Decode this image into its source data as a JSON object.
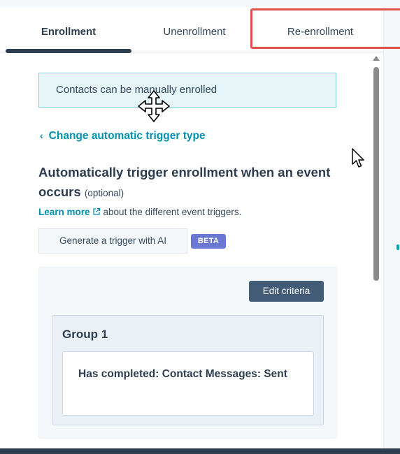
{
  "tabs": [
    {
      "label": "Enrollment"
    },
    {
      "label": "Unenrollment"
    },
    {
      "label": "Re-enrollment"
    }
  ],
  "alert": {
    "text": "Contacts can be manually enrolled"
  },
  "back_link": {
    "chevron": "‹",
    "label": "Change automatic trigger type"
  },
  "heading": {
    "main": "Automatically trigger enrollment when an event occurs",
    "optional": "(optional)"
  },
  "learn_more": {
    "link": "Learn more",
    "icon": "external-link-icon",
    "text": "about the different event triggers."
  },
  "generate_button": {
    "label": "Generate a trigger with AI"
  },
  "beta_badge": {
    "label": "BETA"
  },
  "edit_criteria_button": {
    "label": "Edit criteria"
  },
  "group": {
    "title": "Group 1",
    "filter": "Has completed: Contact Messages: Sent"
  },
  "colors": {
    "accent": "#0091ae",
    "highlight": "#e2504b",
    "beta": "#6a78d1",
    "dark_button": "#425b76"
  }
}
